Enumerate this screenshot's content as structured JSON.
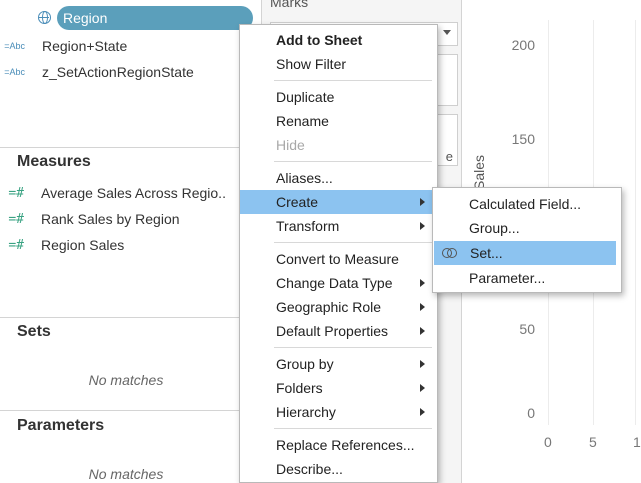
{
  "data_pane": {
    "dimensions": [
      {
        "label": "Region",
        "icon": "globe-icon",
        "selected": true
      },
      {
        "label": "Region+State",
        "icon": "abc-icon",
        "type_glyph": "=Abc"
      },
      {
        "label": "z_SetActionRegionState",
        "icon": "abc-icon",
        "type_glyph": "=Abc"
      }
    ],
    "measures_title": "Measures",
    "measures": [
      {
        "label": "Average Sales Across Regio..",
        "icon": "calculated-measure-icon",
        "type_glyph": "=#"
      },
      {
        "label": "Rank Sales by Region",
        "icon": "calculated-measure-icon",
        "type_glyph": "=#"
      },
      {
        "label": "Region Sales",
        "icon": "calculated-measure-icon",
        "type_glyph": "=#"
      }
    ],
    "sets_title": "Sets",
    "sets_empty": "No matches",
    "parameters_title": "Parameters",
    "parameters_empty": "No matches"
  },
  "marks": {
    "title": "Marks",
    "partial_glyph": "e"
  },
  "chart": {
    "y_axis_label": "Sales",
    "y_ticks": [
      "200",
      "150",
      "50",
      "0"
    ],
    "x_ticks": [
      "0",
      "5",
      "1"
    ]
  },
  "context_menu": {
    "items": [
      {
        "label": "Add to Sheet",
        "style": "bold"
      },
      {
        "label": "Show Filter"
      },
      {
        "label": "Duplicate"
      },
      {
        "label": "Rename"
      },
      {
        "label": "Hide",
        "style": "disabled"
      },
      {
        "label": "Aliases..."
      },
      {
        "label": "Create",
        "style": "highlight",
        "submenu": true
      },
      {
        "label": "Transform",
        "submenu": true
      },
      {
        "label": "Convert to Measure"
      },
      {
        "label": "Change Data Type",
        "submenu": true
      },
      {
        "label": "Geographic Role",
        "submenu": true
      },
      {
        "label": "Default Properties",
        "submenu": true
      },
      {
        "label": "Group by",
        "submenu": true
      },
      {
        "label": "Folders",
        "submenu": true
      },
      {
        "label": "Hierarchy",
        "submenu": true
      },
      {
        "label": "Replace References..."
      },
      {
        "label": "Describe..."
      }
    ]
  },
  "create_submenu": {
    "items": [
      {
        "label": "Calculated Field..."
      },
      {
        "label": "Group..."
      },
      {
        "label": "Set...",
        "style": "highlight",
        "icon": "set-icon"
      },
      {
        "label": "Parameter..."
      }
    ]
  },
  "colors": {
    "highlight": "#8cc3f0",
    "pill": "#5b9fbb",
    "dimension_icon": "#4a8db8",
    "measure_icon": "#3aa383"
  }
}
